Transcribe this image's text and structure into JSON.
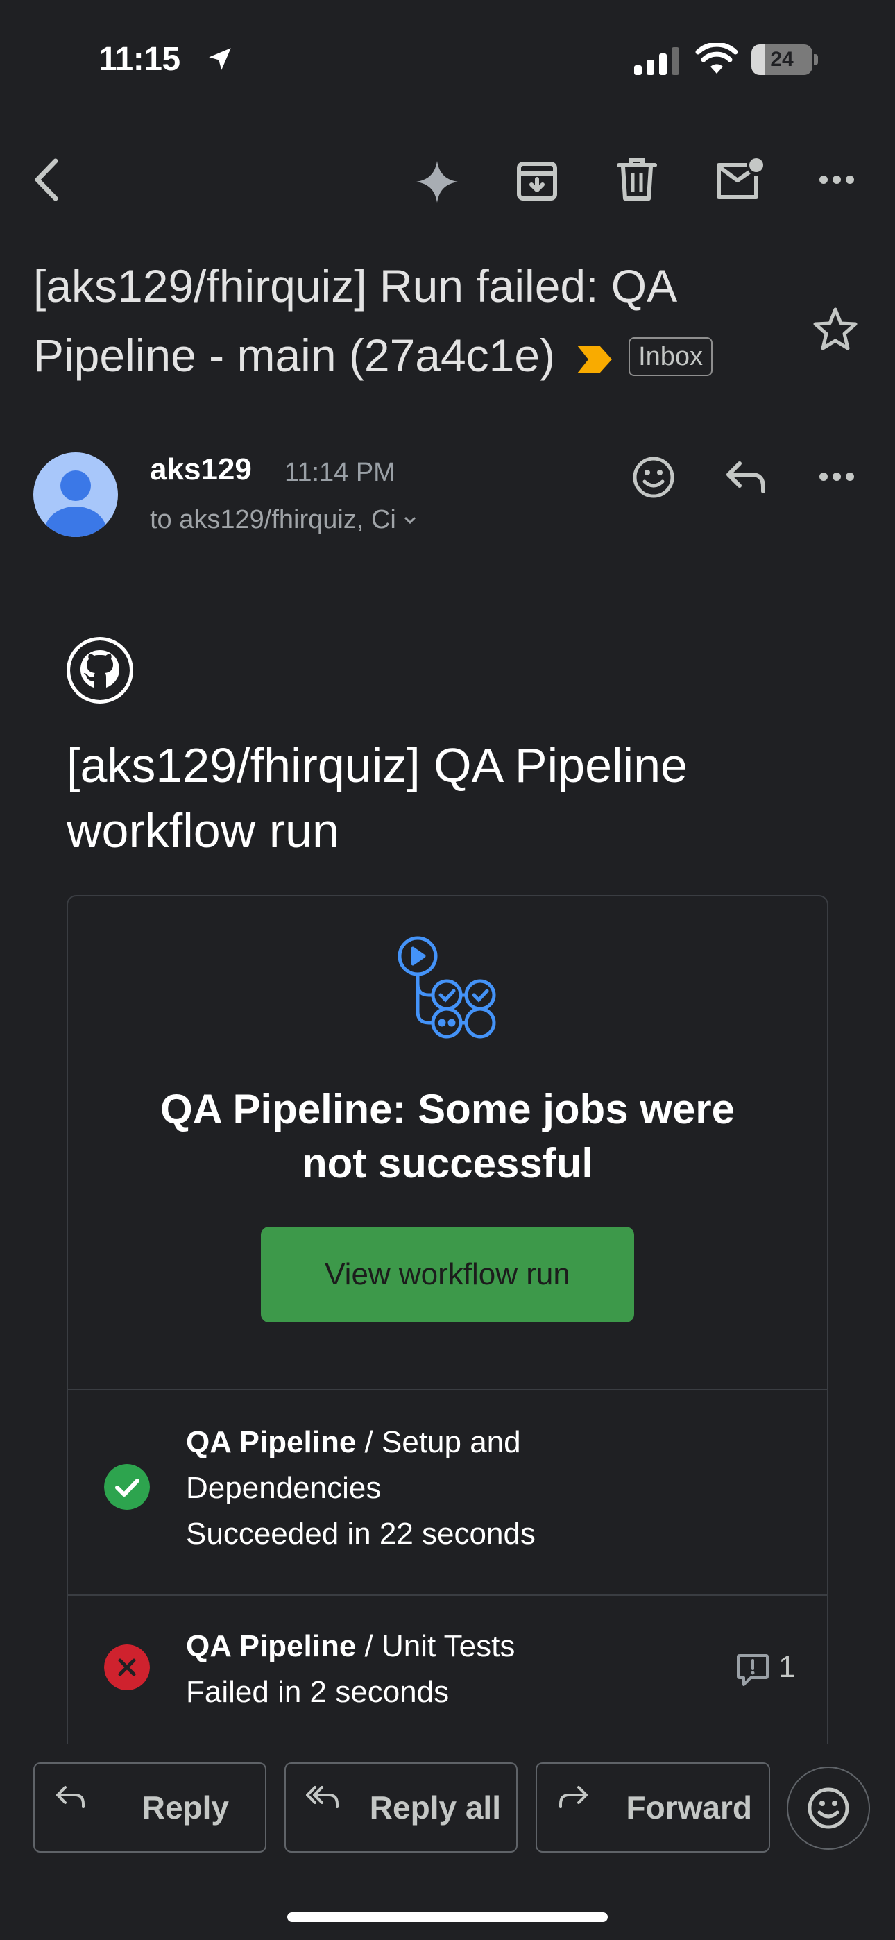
{
  "status_bar": {
    "time": "11:15",
    "battery": "24"
  },
  "email": {
    "subject": "[aks129/fhirquiz] Run failed: QA Pipeline - main (27a4c1e)",
    "label": "Inbox",
    "sender": "aks129",
    "time": "11:14 PM",
    "recipients": "to aks129/fhirquiz, Ci"
  },
  "body": {
    "heading": "[aks129/fhirquiz] QA Pipeline workflow run",
    "card_title": "QA Pipeline: Some jobs were not successful",
    "view_button": "View workflow run",
    "jobs": [
      {
        "workflow": "QA Pipeline",
        "sep": " / ",
        "name": "Setup and Dependencies",
        "status": "Succeeded in 22 seconds",
        "result": "success"
      },
      {
        "workflow": "QA Pipeline",
        "sep": " / ",
        "name": "Unit Tests",
        "status": "Failed in 2 seconds",
        "result": "failure",
        "annotations": "1"
      }
    ]
  },
  "actions": {
    "reply": "Reply",
    "reply_all": "Reply all",
    "forward": "Forward"
  },
  "colors": {
    "background": "#1f2023",
    "success": "#2da44e",
    "failure": "#cf222e",
    "button_green": "#3d994a",
    "label_chevron": "#f9ab00",
    "workflow_icon": "#4493f8"
  }
}
